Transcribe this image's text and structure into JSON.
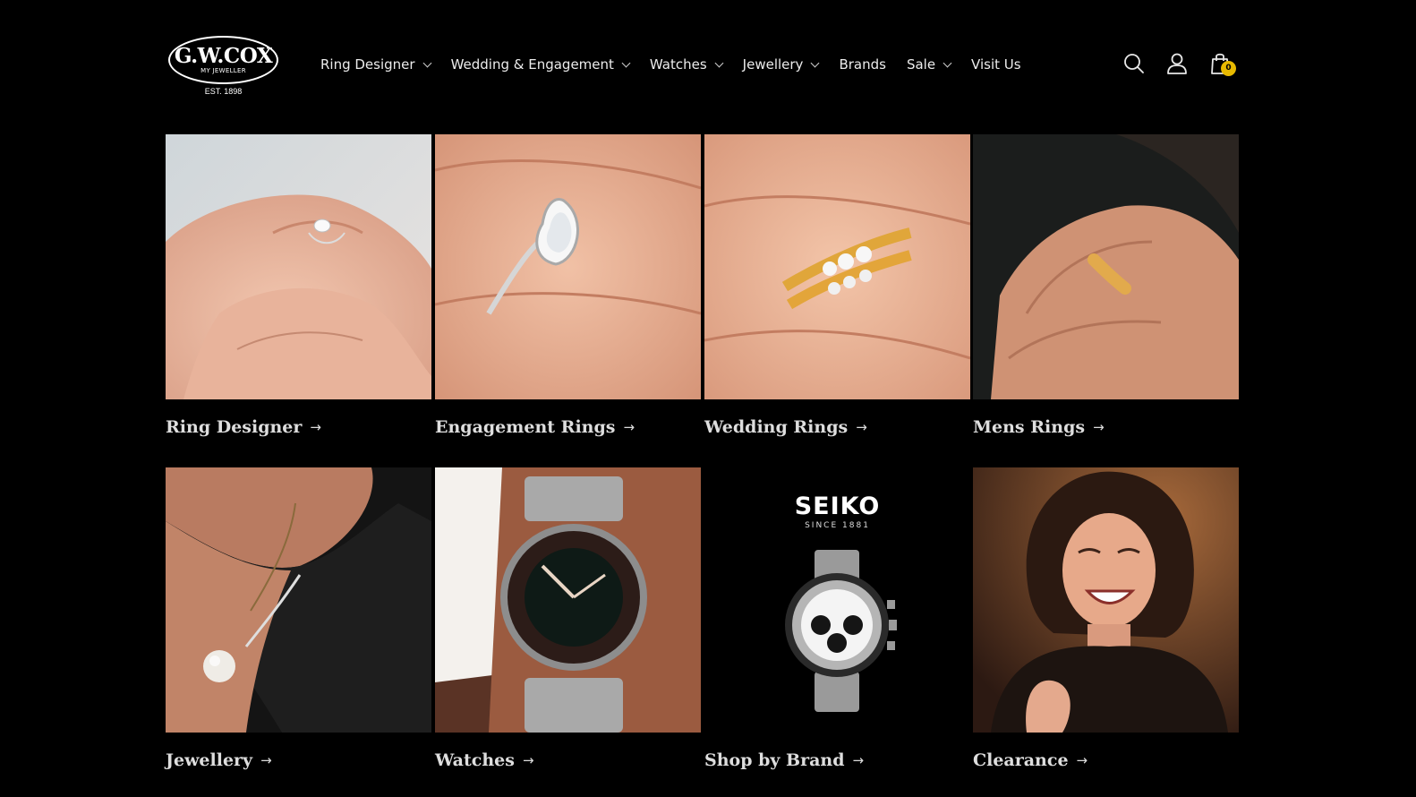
{
  "brand": {
    "name": "G.W.COX",
    "tagline": "MY JEWELLER",
    "established": "EST. 1898"
  },
  "nav": {
    "items": [
      {
        "label": "Ring Designer",
        "has_dropdown": true
      },
      {
        "label": "Wedding & Engagement",
        "has_dropdown": true
      },
      {
        "label": "Watches",
        "has_dropdown": true
      },
      {
        "label": "Jewellery",
        "has_dropdown": true
      },
      {
        "label": "Brands",
        "has_dropdown": false
      },
      {
        "label": "Sale",
        "has_dropdown": true
      },
      {
        "label": "Visit Us",
        "has_dropdown": false
      }
    ]
  },
  "header_icons": {
    "search": "search-icon",
    "account": "account-icon",
    "cart": "cart-icon",
    "cart_count": "0"
  },
  "categories": [
    {
      "title": "Ring Designer",
      "arrow": "→",
      "image": "hands-with-solitaire-ring"
    },
    {
      "title": "Engagement Rings",
      "arrow": "→",
      "image": "pear-halo-ring-on-hand"
    },
    {
      "title": "Wedding Rings",
      "arrow": "→",
      "image": "gold-diamond-bands-on-hand"
    },
    {
      "title": "Mens Rings",
      "arrow": "→",
      "image": "mens-gold-band-on-hand"
    },
    {
      "title": "Jewellery",
      "arrow": "→",
      "image": "pearl-pendant-necklace"
    },
    {
      "title": "Watches",
      "arrow": "→",
      "image": "dive-watch-on-wrist"
    },
    {
      "title": "Shop by Brand",
      "arrow": "→",
      "image": "seiko-chronograph",
      "brand_logo": "SEIKO",
      "brand_since": "SINCE 1881"
    },
    {
      "title": "Clearance",
      "arrow": "→",
      "image": "smiling-woman-with-ring"
    }
  ],
  "colors": {
    "background": "#000000",
    "text": "#ececec",
    "badge": "#e7b900"
  }
}
